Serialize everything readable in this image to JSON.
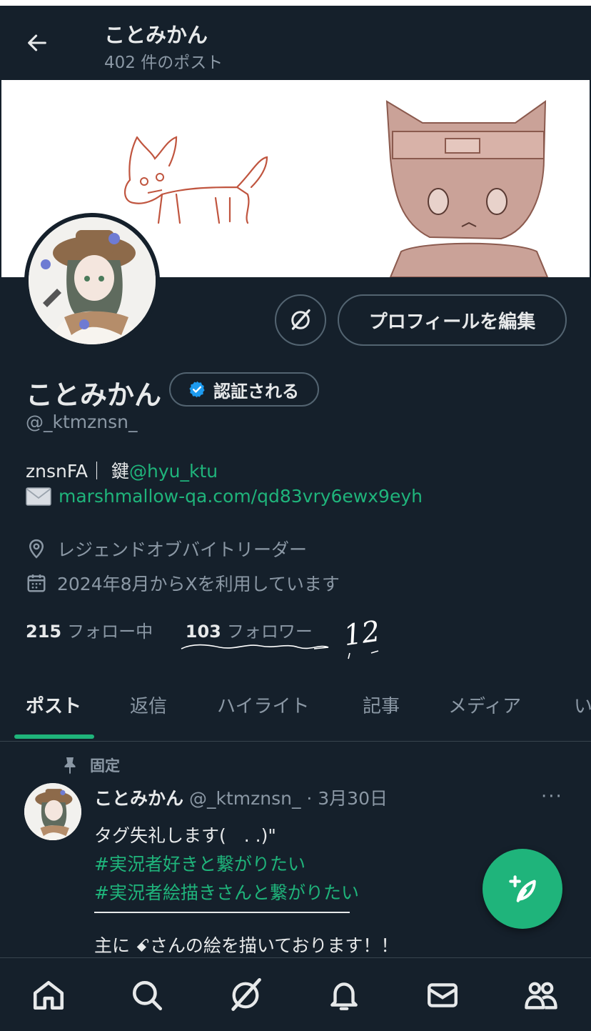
{
  "header": {
    "title": "ことみかん",
    "post_count": "402 件のポスト"
  },
  "profile": {
    "name": "ことみかん",
    "verify_label": "認証される",
    "handle": "@_ktmznsn_",
    "edit_label": "プロフィールを編集",
    "bio_prefix": "znsnFA｜ 鍵",
    "bio_mention": "@hyu_ktu",
    "bio_link": "marshmallow-qa.com/qd83vry6ewx9eyh",
    "location": "レジェンドオブバイトリーダー",
    "joined": "2024年8月からXを利用しています",
    "following_count": "215",
    "following_label": "フォロー中",
    "followers_count": "103",
    "followers_label": "フォロワー",
    "handwritten_note": "12"
  },
  "tabs": [
    {
      "label": "ポスト",
      "active": true
    },
    {
      "label": "返信"
    },
    {
      "label": "ハイライト"
    },
    {
      "label": "記事"
    },
    {
      "label": "メディア"
    },
    {
      "label": "い"
    }
  ],
  "post": {
    "pinned_label": "固定",
    "author": "ことみかん",
    "handle_date": "@_ktmznsn_ · 3月30日",
    "more": "···",
    "line1": "タグ失礼します(　. .)\"",
    "tag1": "#実況者好きと繋がりたい",
    "tag2": "#実況者絵描きさんと繋がりたい",
    "line4": "主に ꗃさんの絵を描いております！！"
  },
  "colors": {
    "background": "#15202b",
    "accent": "#1fb47b",
    "verified": "#1d9bf0",
    "muted_text": "#8b98a5"
  },
  "bottom_nav": [
    "home-icon",
    "search-icon",
    "grok-icon",
    "bell-icon",
    "mail-icon",
    "communities-icon"
  ]
}
